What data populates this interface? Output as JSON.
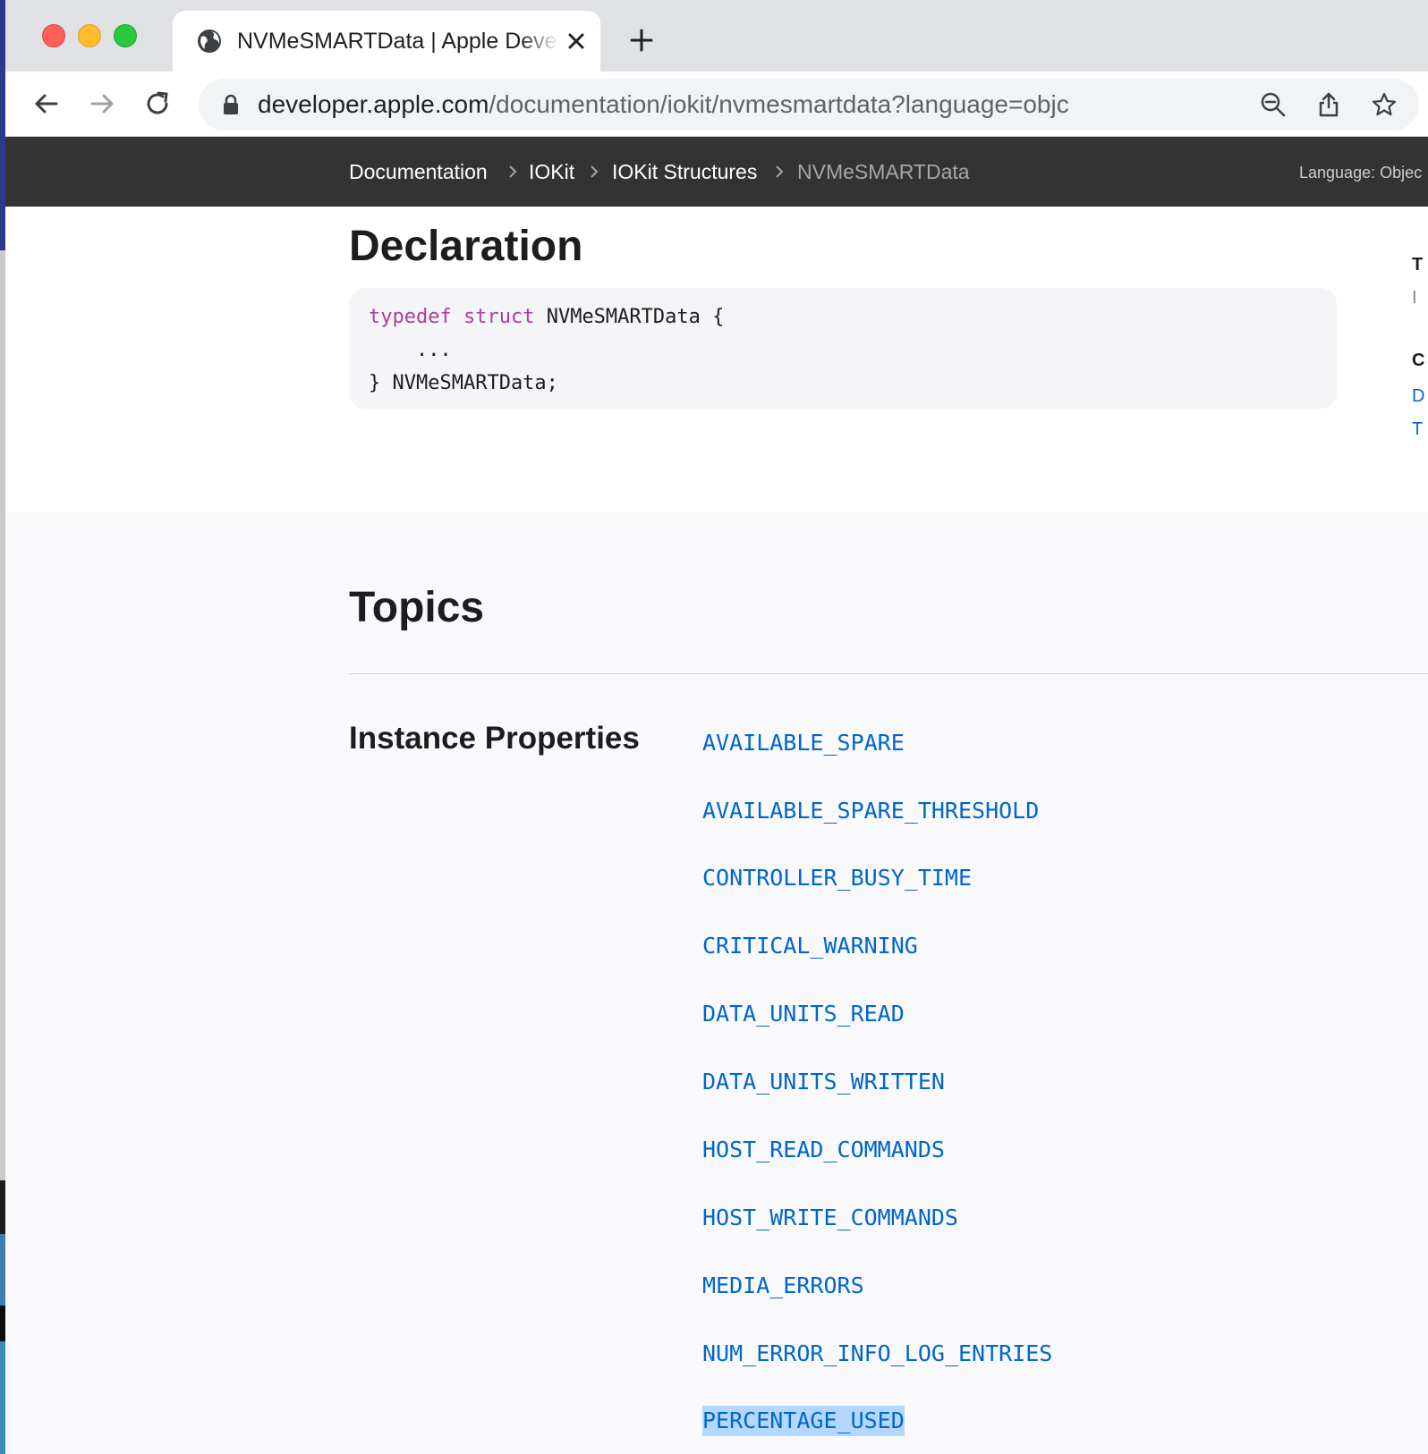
{
  "browser": {
    "tab_title": "NVMeSMARTData | Apple Developer Documentation",
    "url_host": "developer.apple.com",
    "url_path": "/documentation/iokit/nvmesmartdata?language=objc",
    "new_tab_label": "+"
  },
  "icons": {
    "globe": "globe-icon",
    "close": "close-icon",
    "back": "back-arrow-icon",
    "forward": "forward-arrow-icon",
    "reload": "reload-icon",
    "lock": "lock-icon",
    "zoom": "zoom-out-icon",
    "share": "share-icon",
    "bookmark": "star-icon"
  },
  "docnav": {
    "breadcrumbs": [
      "Documentation",
      "IOKit",
      "IOKit Structures",
      "NVMeSMARTData"
    ],
    "language_label": "Language:",
    "language_value": "Objec"
  },
  "declaration": {
    "heading": "Declaration",
    "code_kw1": "typedef",
    "code_kw2": "struct",
    "code_name": "NVMeSMARTData {",
    "code_line2": "    ...",
    "code_line3": "} NVMeSMARTData;"
  },
  "side_fragments": [
    "T",
    "I",
    "C",
    "D",
    "T"
  ],
  "topics": {
    "heading": "Topics",
    "group_title": "Instance Properties",
    "properties": [
      "AVAILABLE_SPARE",
      "AVAILABLE_SPARE_THRESHOLD",
      "CONTROLLER_BUSY_TIME",
      "CRITICAL_WARNING",
      "DATA_UNITS_READ",
      "DATA_UNITS_WRITTEN",
      "HOST_READ_COMMANDS",
      "HOST_WRITE_COMMANDS",
      "MEDIA_ERRORS",
      "NUM_ERROR_INFO_LOG_ENTRIES",
      "PERCENTAGE_USED"
    ],
    "selected_property": "PERCENTAGE_USED"
  },
  "colors": {
    "link": "#0066cc",
    "keyword": "#ad3da4",
    "selection": "#b3d7fe",
    "nav_bg": "#333333"
  }
}
